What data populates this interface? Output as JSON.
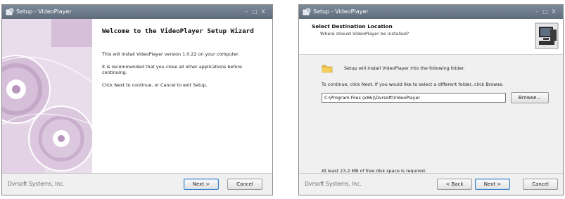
{
  "window1": {
    "title": "Setup - VideoPlayer",
    "controls": [
      "–",
      "□",
      "X"
    ],
    "welcome_heading": "Welcome to the VideoPlayer Setup Wizard",
    "paragraph1": "This will install VideoPlayer version 1.0.22 on your computer.",
    "paragraph2": "It is recommended that you close all other applications before continuing.",
    "paragraph3": "Click Next to continue, or Cancel to exit Setup.",
    "company": "Dvrsoft Systems, Inc.",
    "next_button": "Next >",
    "cancel_button": "Cancel"
  },
  "window2": {
    "title": "Setup - VideoPlayer",
    "controls": [
      "–",
      "□",
      "X"
    ],
    "header_title": "Select Destination Location",
    "header_subtitle": "Where should VideoPlayer be installed?",
    "folder_text": "Setup will install VideoPlayer into the following folder.",
    "instruction": "To continue, click Next. If you would like to select a different folder, click Browse.",
    "install_path": "C:\\Program Files (x86)\\Dvrsoft\\VideoPlayer",
    "browse_button": "Browse...",
    "disk_space": "At least 23.2 MB of free disk space is required.",
    "company": "Dvrsoft Systems, Inc.",
    "back_button": "< Back",
    "next_button": "Next >",
    "cancel_button": "Cancel"
  },
  "colors": {
    "titlebar": "#6b7888",
    "side_panel": "#d9c7da",
    "default_button_border": "#3f82c9"
  },
  "icons": [
    "setup-app-icon",
    "disc-graphic",
    "folder-icon",
    "computer-icon"
  ]
}
